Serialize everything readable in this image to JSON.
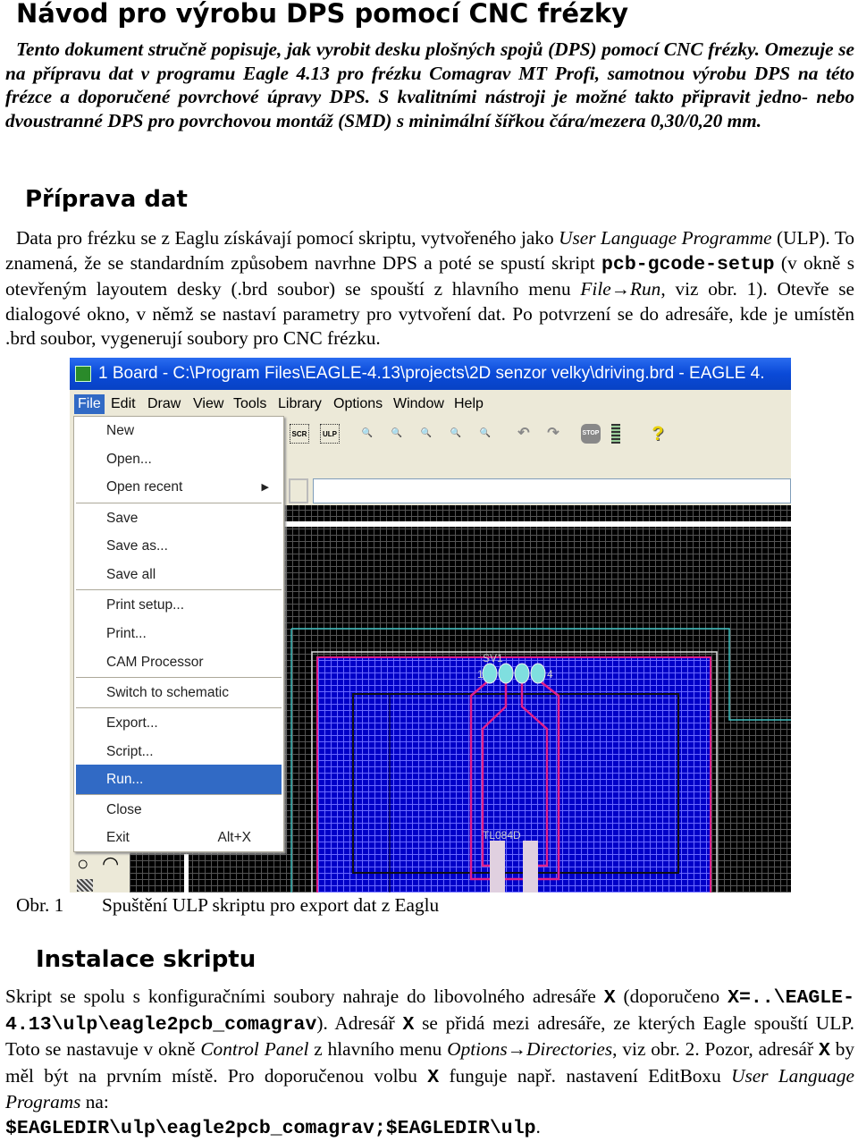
{
  "title": "Návod pro výrobu DPS pomocí CNC frézky",
  "intro": "Tento dokument stručně popisuje, jak vyrobit desku plošných spojů (DPS) pomocí CNC frézky. Omezuje se na přípravu dat v programu Eagle 4.13 pro frézku Comagrav MT Profi, samotnou výrobu DPS na této frézce a doporučené povrchové úpravy DPS. S kvalitními nástroji je možné takto připravit jedno- nebo dvoustranné DPS pro povrchovou montáž (SMD) s minimální šířkou čára/mezera 0,30/0,20 mm.",
  "section1": {
    "heading": "Příprava dat",
    "p": [
      "Data pro frézku se z Eaglu získávají pomocí skriptu, vytvořeného jako ",
      "User Language Programme",
      " (ULP). To znamená, že se standardním způsobem navrhne DPS a poté se spustí skript ",
      "pcb-gcode-setup",
      " (v okně s otevřeným layoutem desky (.brd soubor) se spouští z hlavního menu ",
      "File→Run",
      ", viz obr. 1). Otevře se dialogové okno, v němž se nastaví parametry pro vytvoření dat. Po potvrzení se do adresáře, kde je umístěn .brd soubor, vygenerují soubory pro CNC frézku."
    ]
  },
  "figure1": {
    "window_title": "1 Board - C:\\Program Files\\EAGLE-4.13\\projects\\2D senzor velky\\driving.brd - EAGLE 4.",
    "menubar": [
      "File",
      "Edit",
      "Draw",
      "View",
      "Tools",
      "Library",
      "Options",
      "Window",
      "Help"
    ],
    "toolbar": [
      "SCR",
      "ULP",
      "zoom-fit-icon",
      "zoom-in-icon",
      "zoom-out-icon",
      "zoom-select-icon",
      "zoom-area-icon",
      "undo-icon",
      "redo-icon",
      "STOP",
      "go-icon",
      "?"
    ],
    "file_menu": [
      {
        "label": "New"
      },
      {
        "label": "Open..."
      },
      {
        "label": "Open recent",
        "submenu": true
      },
      {
        "label": "Save"
      },
      {
        "label": "Save as..."
      },
      {
        "label": "Save all"
      },
      {
        "label": "Print setup..."
      },
      {
        "label": "Print..."
      },
      {
        "label": "CAM Processor"
      },
      {
        "label": "Switch to schematic"
      },
      {
        "label": "Export..."
      },
      {
        "label": "Script..."
      },
      {
        "label": "Run...",
        "highlighted": true
      },
      {
        "label": "Close"
      },
      {
        "label": "Exit",
        "shortcut": "Alt+X"
      }
    ],
    "board_labels": {
      "connector": "SV1",
      "pin_first": "1",
      "pin_last": "4",
      "ic": "TL084D"
    },
    "colors": {
      "board_fill": "#0000c8",
      "trace": "#e0208c",
      "outline": "#40c0c0",
      "selection": "#316ac5"
    },
    "caption_num": "Obr. 1",
    "caption": "Spuštění ULP skriptu pro export dat z Eaglu"
  },
  "section2": {
    "heading": "Instalace skriptu",
    "p": [
      "Skript se spolu s konfiguračními soubory nahraje do libovolného adresáře ",
      "X",
      " (doporučeno ",
      "X=..\\EAGLE-4.13\\ulp\\eagle2pcb_comagrav",
      "). Adresář ",
      "X",
      " se přidá mezi adresáře, ze kterých Eagle spouští ULP. Toto se nastavuje v okně ",
      "Control Panel",
      " z hlavního menu ",
      "Options→Directories",
      ", viz obr. 2. Pozor, adresář ",
      "X",
      " by měl být na prvním místě. Pro doporučenou volbu ",
      "X",
      "  funguje např. nastavení EditBoxu ",
      "User Language Programs",
      " na: ",
      "$EAGLEDIR\\ulp\\eagle2pcb_comagrav;$EAGLEDIR\\ulp",
      "."
    ]
  }
}
